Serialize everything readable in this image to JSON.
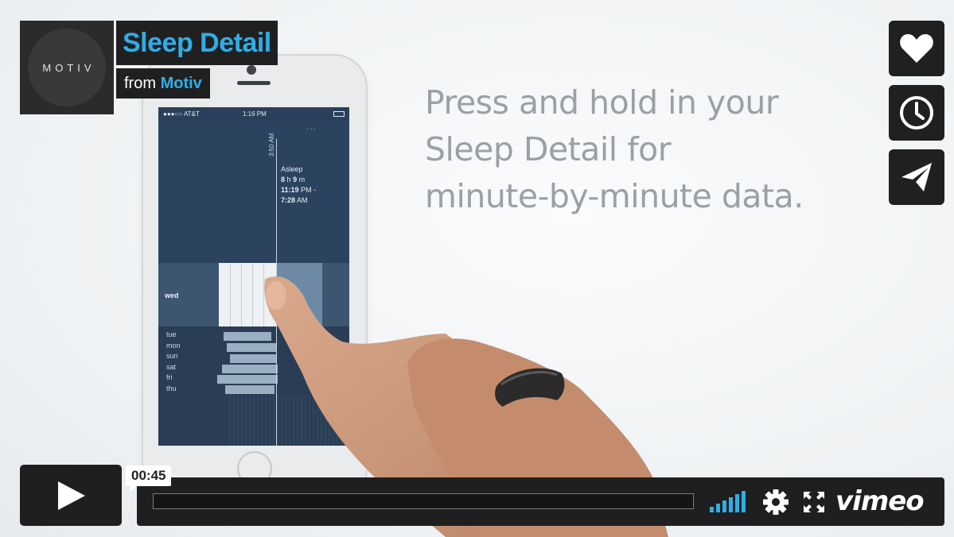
{
  "video": {
    "title": "Sleep Detail",
    "byline_prefix": "from",
    "owner": "Motiv",
    "logo_text": "MOTIV",
    "caption_lines": [
      "Press and hold in your",
      "Sleep Detail for",
      "minute-by-minute data."
    ]
  },
  "phone_screen": {
    "carrier": "●●●○○ AT&T",
    "clock": "1:16 PM",
    "more": "···",
    "timeline_time": "3:50 AM",
    "status": "Asleep",
    "duration_hours": "8",
    "duration_h_unit": "h",
    "duration_minutes": "9",
    "duration_m_unit": "m",
    "start_time": "11:19",
    "start_suffix": "PM -",
    "end_time": "7:28",
    "end_suffix": "AM",
    "selected_day": "wed",
    "days": [
      "tue",
      "mon",
      "sun",
      "sat",
      "fri",
      "thu"
    ]
  },
  "side_actions": [
    {
      "icon": "heart-icon",
      "label": "Like"
    },
    {
      "icon": "clock-icon",
      "label": "Watch Later"
    },
    {
      "icon": "paper-plane-icon",
      "label": "Share"
    }
  ],
  "player": {
    "timecode": "00:45",
    "progress": 0.0,
    "brand": "vimeo",
    "accent_color": "#2faee8",
    "icons": [
      "play-icon",
      "volume-icon",
      "gear-icon",
      "fullscreen-icon"
    ]
  }
}
